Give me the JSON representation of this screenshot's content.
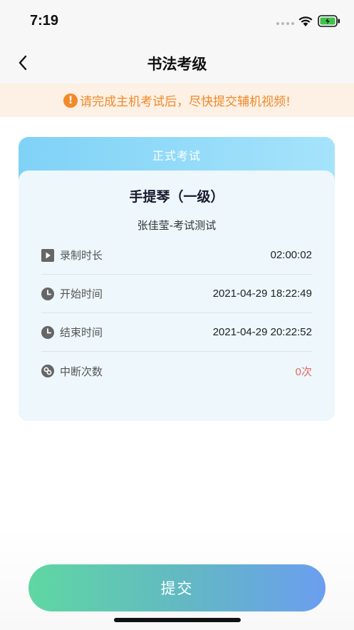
{
  "status_bar": {
    "time": "7:19"
  },
  "nav": {
    "title": "书法考级"
  },
  "notice": {
    "icon_text": "!",
    "text": "请完成主机考试后，尽快提交辅机视频!",
    "color": "#ee8a2b"
  },
  "card": {
    "header": "正式考试",
    "course_title": "手提琴（一级）",
    "course_sub": "张佳莹-考试测试",
    "rows": [
      {
        "icon": "play-icon",
        "label": "录制时长",
        "value": "02:00:02"
      },
      {
        "icon": "clock-icon",
        "label": "开始时间",
        "value": "2021-04-29 18:22:49"
      },
      {
        "icon": "clock-icon",
        "label": "结束时间",
        "value": "2021-04-29 20:22:52"
      },
      {
        "icon": "link-icon",
        "label": "中断次数",
        "value": "0次"
      }
    ]
  },
  "submit": {
    "label": "提交"
  },
  "colors": {
    "accent_orange": "#f28a2b",
    "card_header": "#7fd2f7",
    "interrupt_red": "#e0665f"
  }
}
